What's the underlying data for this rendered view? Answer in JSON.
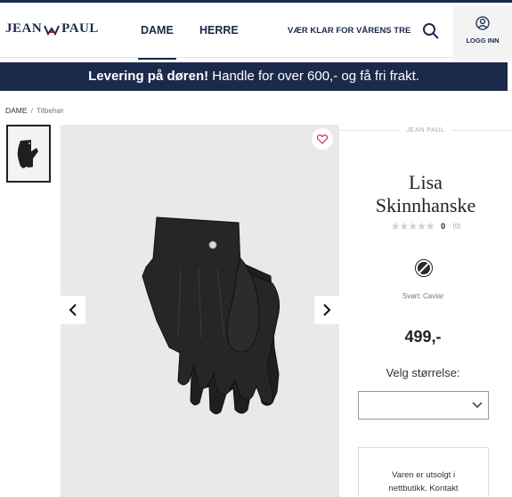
{
  "header": {
    "logo_left": "JEAN",
    "logo_right": "PAUL",
    "tabs": [
      {
        "label": "DAME",
        "active": true
      },
      {
        "label": "HERRE",
        "active": false
      }
    ],
    "promo_link": "VÆR KLAR FOR VÅRENS TRE",
    "search_icon": "search-icon",
    "login_label": "LOGG INN",
    "login_icon": "user-icon"
  },
  "banner": {
    "bold_text": "Levering på døren!",
    "text": " Handle for over 600,- og få fri frakt."
  },
  "breadcrumb": {
    "items": [
      "DAME",
      "Tilbehør"
    ]
  },
  "product": {
    "brand": "JEAN PAUL",
    "title": "Lisa Skinnhanske",
    "rating_count": "0",
    "review_count": "(0)",
    "color_name": "Svart: Caviar",
    "price": "499,-",
    "size_label": "Velg størrelse:",
    "size_selected": "",
    "stock_message_line1": "Varen er utsolgt i",
    "stock_message_line2": "nettbutikk. Kontakt"
  },
  "colors": {
    "navy": "#1b2a4a",
    "gallery_bg": "#e9e9e9",
    "logo_red": "#c8102e"
  }
}
